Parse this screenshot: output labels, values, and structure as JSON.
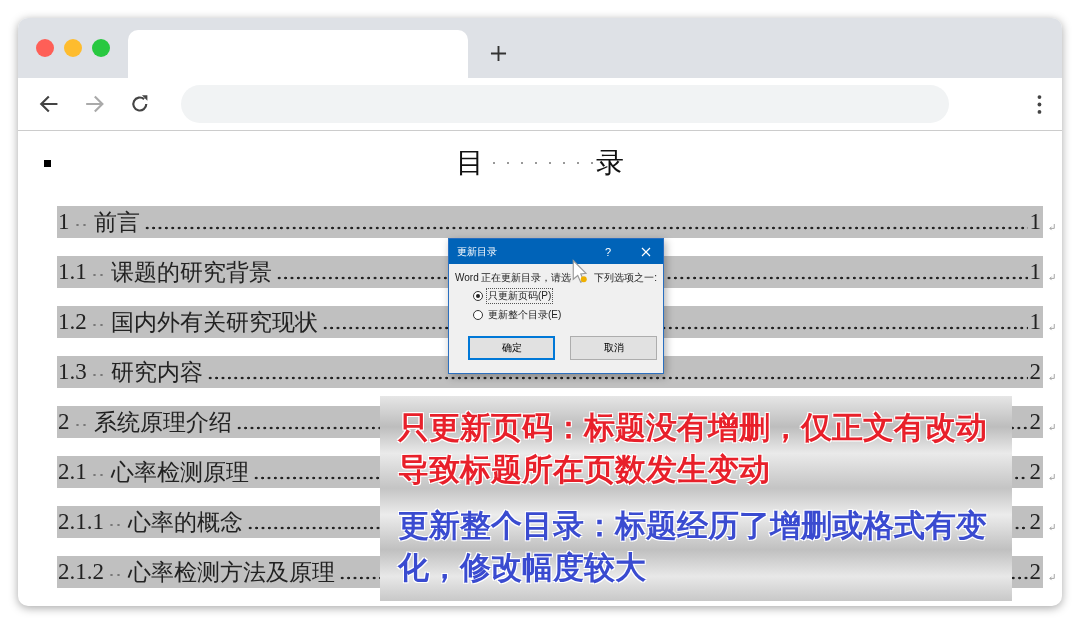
{
  "document": {
    "title_start": "目",
    "title_end": "录",
    "toc": [
      {
        "number": "1",
        "title": "前言",
        "page": "1"
      },
      {
        "number": "1.1",
        "title": "课题的研究背景",
        "page": "1"
      },
      {
        "number": "1.2",
        "title": "国内外有关研究现状",
        "page": "1"
      },
      {
        "number": "1.3",
        "title": "研究内容",
        "page": "2"
      },
      {
        "number": "2",
        "title": "系统原理介绍",
        "page": "2"
      },
      {
        "number": "2.1",
        "title": "心率检测原理",
        "page": "2"
      },
      {
        "number": "2.1.1",
        "title": "心率的概念",
        "page": "2"
      },
      {
        "number": "2.1.2",
        "title": "心率检测方法及原理",
        "page": "2"
      }
    ]
  },
  "dialog": {
    "title": "更新目录",
    "help": "?",
    "prompt_before": "Word 正在更新目录，请选",
    "prompt_after": "下列选项之一:",
    "options": [
      {
        "label": "只更新页码(P)",
        "selected": true
      },
      {
        "label": "更新整个目录(E)",
        "selected": false
      }
    ],
    "buttons": [
      {
        "label": "确定",
        "default": true
      },
      {
        "label": "取消",
        "default": false
      }
    ]
  },
  "notes": [
    {
      "text": "只更新页码：标题没有增删，仅正文有改动导致标题所在页数发生变动",
      "color": "#e8202a"
    },
    {
      "text": "更新整个目录：标题经历了增删或格式有变化，修改幅度较大",
      "color": "#3a4bd0"
    }
  ]
}
